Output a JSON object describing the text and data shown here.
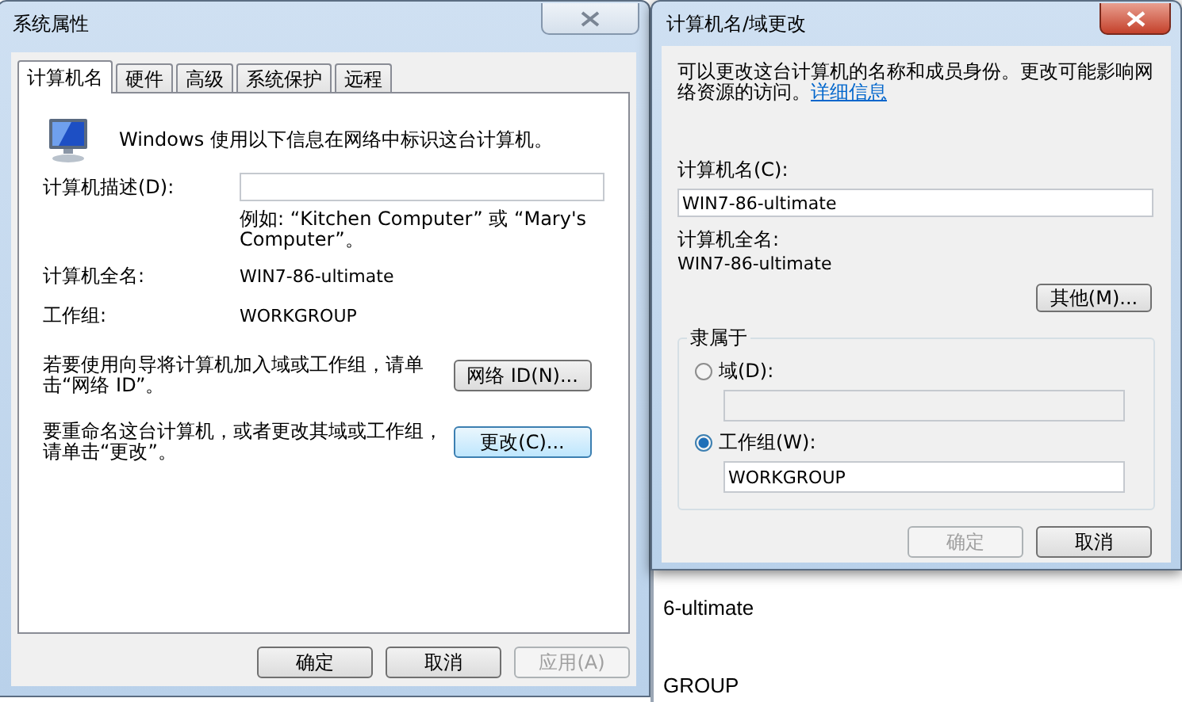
{
  "background_window": {
    "texts": [
      "6-ultimate",
      "GROUP"
    ]
  },
  "system_properties": {
    "title": "系统属性",
    "tabs": [
      {
        "label": "计算机名",
        "selected": true
      },
      {
        "label": "硬件",
        "selected": false
      },
      {
        "label": "高级",
        "selected": false
      },
      {
        "label": "系统保护",
        "selected": false
      },
      {
        "label": "远程",
        "selected": false
      }
    ],
    "intro": "Windows 使用以下信息在网络中标识这台计算机。",
    "description_label": "计算机描述(D):",
    "example": "例如: “Kitchen Computer” 或 “Mary's Computer”。",
    "full_name_label": "计算机全名:",
    "full_name": "WIN7-86-ultimate",
    "workgroup_label": "工作组:",
    "workgroup": "WORKGROUP",
    "network_id_text": "若要使用向导将计算机加入域或工作组，请单击“网络 ID”。",
    "network_id_button": "网络 ID(N)...",
    "rename_text": "要重命名这台计算机，或者更改其域或工作组，请单击“更改”。",
    "change_button": "更改(C)...",
    "buttons": [
      {
        "label": "确定",
        "disabled": false
      },
      {
        "label": "取消",
        "disabled": false
      },
      {
        "label": "应用(A)",
        "disabled": true
      }
    ]
  },
  "rename_dialog": {
    "title": "计算机名/域更改",
    "intro": "可以更改这台计算机的名称和成员身份。更改可能影响网络资源的访问。",
    "more_info_link": "详细信息",
    "computer_name_label": "计算机名(C):",
    "computer_name": "WIN7-86-ultimate",
    "full_name_label": "计算机全名:",
    "full_name": "WIN7-86-ultimate",
    "other_button": "其他(M)...",
    "member_of": {
      "legend": "隶属于",
      "options": [
        {
          "label": "域(D):",
          "selected": false
        },
        {
          "label": "工作组(W):",
          "selected": true,
          "value": "WORKGROUP"
        }
      ]
    },
    "buttons": [
      {
        "label": "确定",
        "disabled": true
      },
      {
        "label": "取消",
        "disabled": false
      }
    ]
  }
}
